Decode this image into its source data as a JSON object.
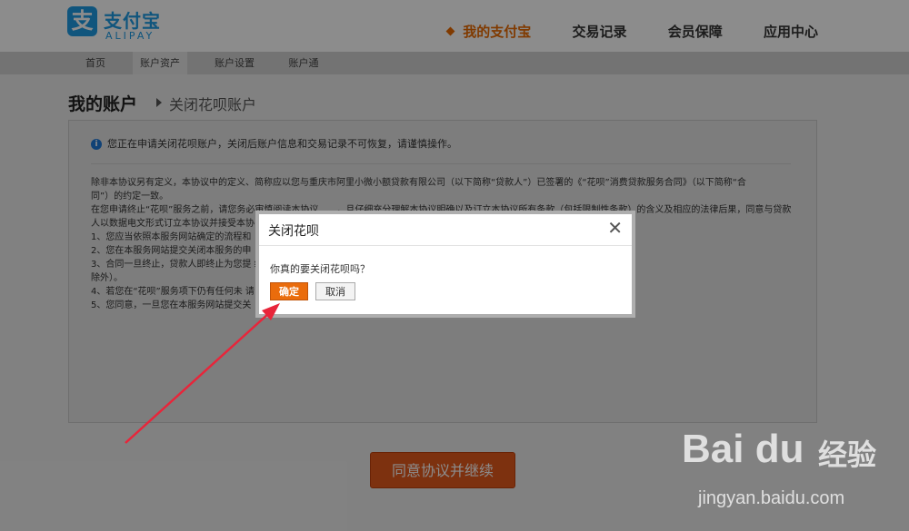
{
  "header": {
    "logo_cn": "支付宝",
    "logo_en": "ALIPAY",
    "logo_mark": "支",
    "nav": [
      "我的支付宝",
      "交易记录",
      "会员保障",
      "应用中心"
    ]
  },
  "subnav": [
    "首页",
    "账户资产",
    "账户设置",
    "账户通"
  ],
  "page": {
    "title": "我的账户",
    "breadcrumb": "关闭花呗账户",
    "notice": "您正在申请关闭花呗账户，关闭后账户信息和交易记录不可恢复，请谨慎操作。",
    "terms": [
      "除非本协议另有定义，本协议中的定义、简称应以您与重庆市阿里小微小额贷款有限公司（以下简称“贷款人”）已签署的《“花呗”消费贷款服务合同》（以下简称“合",
      "同”）的约定一致。",
      "在您申请终止“花呗”服务之前，请您务必审慎阅读本协议……，且仔细充分理解本协议明确以及订立本协议所有条款（包括限制性条款）的含义及相应的法律后果，同意与贷款",
      "人以数据电文形式订立本协议并接受本协",
      "1、您应当依照本服务网站确定的流程和",
      "2、您在本服务网站提交关闭本服务的申",
      "3、合同一旦终止，贷款人即终止为您提                                                                                                 约定不得终止的或依其性质不能终止的",
      "除外）。",
      "4、若您在“花呗”服务项下仍有任何未                                                                                                 请，您仍应按合同约定履行相应义务。",
      "5、您同意，一旦您在本服务网站提交关"
    ],
    "agree_button": "同意协议并继续"
  },
  "dialog": {
    "title": "关闭花呗",
    "close_glyph": "✕",
    "message": "你真的要关闭花呗吗？",
    "ok_label": "确定",
    "cancel_label": "取消"
  },
  "watermark": {
    "brand": "Bai du",
    "brand_cn": "经验",
    "url": "jingyan.baidu.com"
  },
  "colors": {
    "alipay_blue": "#1e9be4",
    "accent_orange": "#e96a00",
    "annotation_red": "#e8253a"
  }
}
